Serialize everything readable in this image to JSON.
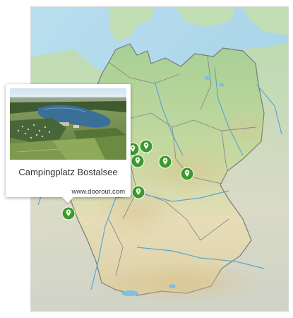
{
  "map": {
    "colors": {
      "sea": "#a9d4e8",
      "lowland": "#a5cf91",
      "upland": "#e8d9b1",
      "border": "#7a7a7a",
      "river": "#5aa7d2",
      "pin": "#3c9a2c"
    }
  },
  "popup": {
    "title": "Campingplatz Bostalsee",
    "source": "www.doorout.com",
    "photo": "aerial-lake-campsite"
  },
  "markers": [
    {
      "name": "marker-bostalsee",
      "icon": "location-pin-icon"
    },
    {
      "name": "marker-1",
      "icon": "location-pin-icon"
    },
    {
      "name": "marker-2",
      "icon": "location-pin-icon"
    },
    {
      "name": "marker-3",
      "icon": "location-pin-icon"
    },
    {
      "name": "marker-4",
      "icon": "location-pin-icon"
    },
    {
      "name": "marker-5",
      "icon": "location-pin-icon"
    },
    {
      "name": "marker-6",
      "icon": "location-pin-icon"
    }
  ]
}
